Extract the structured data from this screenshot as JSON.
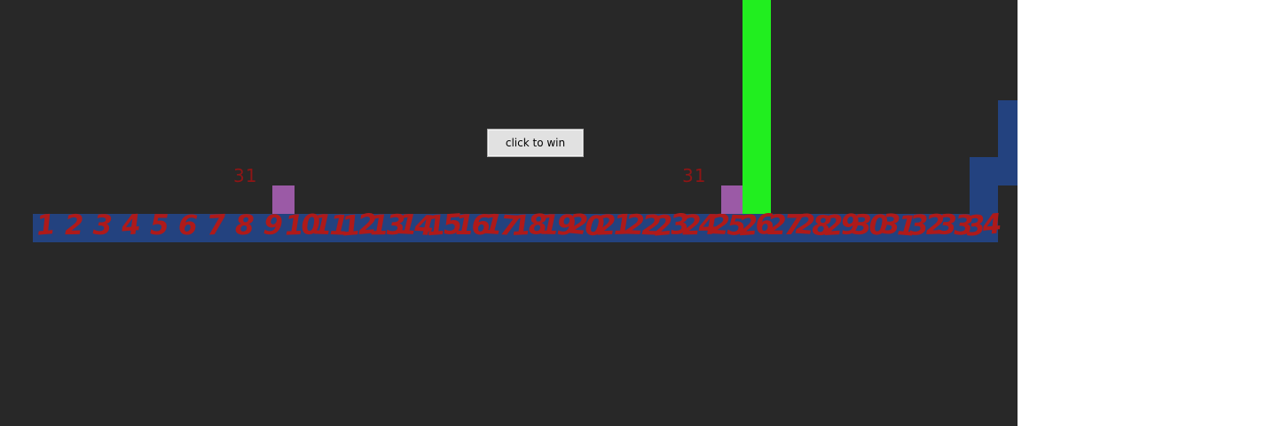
{
  "game": {
    "button_label": "click to win",
    "counters": [
      "31",
      "31"
    ],
    "track_numbers": [
      "1",
      "2",
      "3",
      "4",
      "5",
      "6",
      "7",
      "8",
      "9",
      "10",
      "11",
      "12",
      "13",
      "14",
      "15",
      "16",
      "17",
      "18",
      "19",
      "20",
      "21",
      "22",
      "23",
      "24",
      "25",
      "26",
      "27",
      "28",
      "29",
      "30",
      "31",
      "32",
      "33",
      "34"
    ],
    "colors": {
      "background": "#282828",
      "ground": "#23427f",
      "numbers": "#ae1a1a",
      "player": "#9b5aa6",
      "goal_pillar": "#21ee1f"
    }
  }
}
